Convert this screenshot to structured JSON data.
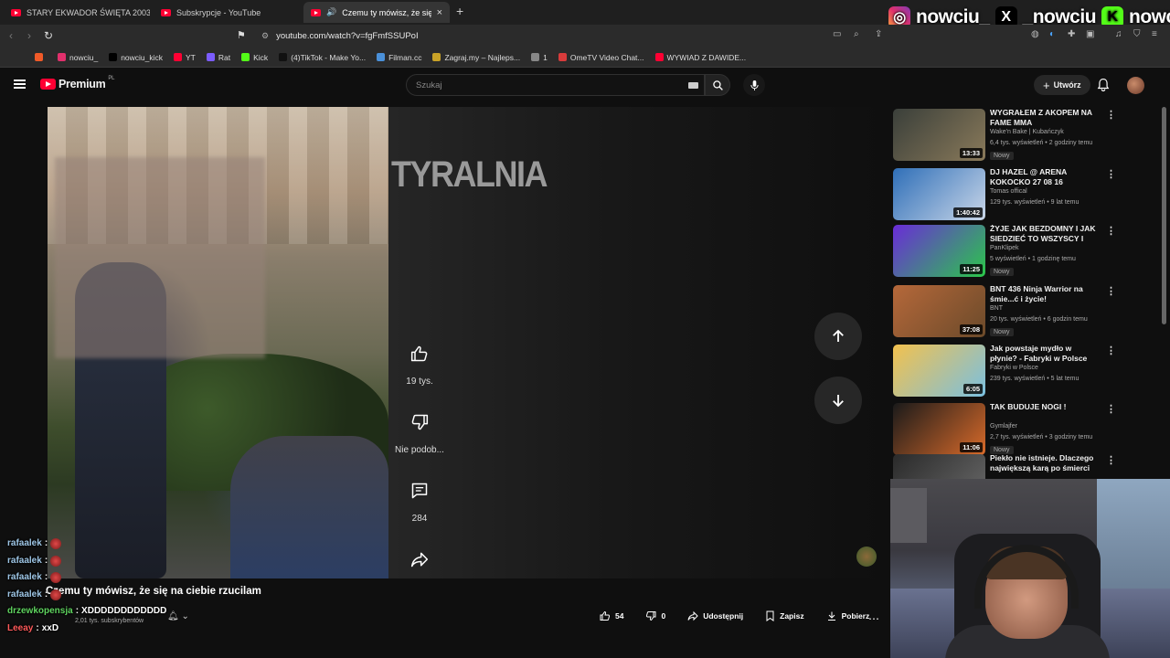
{
  "browser": {
    "tabs": [
      {
        "label": "STARY EKWADOR ŚWIĘTA 2003",
        "active": false
      },
      {
        "label": "Subskrypcje - YouTube",
        "active": false
      },
      {
        "label": "Czemu ty mówisz, że się na ci",
        "active": true
      }
    ],
    "new_tab": "+",
    "close": "×",
    "url": "youtube.com/watch?v=fgFmfSSUPoI",
    "bookmarks": [
      {
        "label": "",
        "color": "#f05a28"
      },
      {
        "label": "nowciu_",
        "color": "#e1306c"
      },
      {
        "label": "nowciu_kick",
        "color": "#000000"
      },
      {
        "label": "YT",
        "color": "#ff0033"
      },
      {
        "label": "Rat",
        "color": "#7b5cff"
      },
      {
        "label": "Kick",
        "color": "#53fc18"
      },
      {
        "label": "(4)TikTok - Make Yo...",
        "color": "#111111"
      },
      {
        "label": "Filman.cc",
        "color": "#4a90d9"
      },
      {
        "label": "Zagraj.my – Najleps...",
        "color": "#c9a227"
      },
      {
        "label": "1",
        "color": "#888888"
      },
      {
        "label": "OmeTV Video Chat...",
        "color": "#d83b3b"
      },
      {
        "label": "WYWIAD Z DAWIDE...",
        "color": "#ff0033"
      }
    ]
  },
  "socials": {
    "instagram": "nowciu_",
    "x": "_nowciu",
    "kick": "nowciu"
  },
  "youtube": {
    "logo_text": "Premium",
    "logo_region": "PL",
    "search_placeholder": "Szukaj",
    "create_label": "Utwórz",
    "overlay_title": "TYRALNIA",
    "likes": "19 tys.",
    "dislike_label": "Nie podob...",
    "comments": "284",
    "video_title": "Czemu ty mówisz, że się na ciebie rzucilam",
    "channel_subs": "2,01 tys. subskrybentów",
    "like_count": "54",
    "dislike_count": "0",
    "share_label": "Udostępnij",
    "save_label": "Zapisz",
    "download_label": "Pobierz"
  },
  "recommendations": [
    {
      "title": "WYGRAŁEM Z AKOPEM NA FAME MMA",
      "channel": "Wake'n Bake | Kubańczyk",
      "meta": "6,4 tys. wyświetleń • 2 godziny temu",
      "badge": "Nowy",
      "duration": "13:33",
      "colors": [
        "#3a3f3a",
        "#8a7a5a"
      ]
    },
    {
      "title": "DJ HAZEL @ ARENA KOKOCKO 27 08 16",
      "channel": "Tomas offical",
      "meta": "129 tys. wyświetleń • 9 lat temu",
      "badge": "",
      "duration": "1:40:42",
      "colors": [
        "#2f6fb8",
        "#c9d6e8"
      ]
    },
    {
      "title": "ŻYJE JAK BEZDOMNY I JAK SIEDZIEĆ TO WSZYSCY I 😂...",
      "channel": "PanKlipek",
      "meta": "5 wyświetleń • 1 godzinę temu",
      "badge": "Nowy",
      "duration": "11:25",
      "colors": [
        "#6a2bd8",
        "#2bc84a"
      ]
    },
    {
      "title": "BNT 436 Ninja Warrior na śmie...ć i życie!",
      "channel": "BNT",
      "meta": "20 tys. wyświetleń • 6 godzin temu",
      "badge": "Nowy",
      "duration": "37:08",
      "colors": [
        "#b5683a",
        "#6b4a2a"
      ]
    },
    {
      "title": "Jak powstaje mydło w płynie? - Fabryki w Polsce",
      "channel": "Fabryki w Polsce",
      "meta": "239 tys. wyświetleń • 5 lat temu",
      "badge": "",
      "duration": "6:05",
      "colors": [
        "#f2c14e",
        "#7ac0e0"
      ]
    },
    {
      "title": "TAK BUDUJE NOGI !",
      "channel": "Gymlajfer",
      "meta": "2,7 tys. wyświetleń • 3 godziny temu",
      "badge": "Nowy",
      "duration": "11:06",
      "colors": [
        "#1a1a1a",
        "#d86a2a"
      ]
    },
    {
      "title": "Piekło nie istnieje. Dlaczego największą karą po śmierci jes...",
      "channel": "",
      "meta": "",
      "badge": "",
      "duration": "",
      "colors": [
        "#2a2a2a",
        "#6a6a6a"
      ]
    }
  ],
  "chat": [
    {
      "user": "rafaalek",
      "msg": "",
      "color": "#9ec6e6",
      "emote": true
    },
    {
      "user": "rafaalek",
      "msg": "",
      "color": "#9ec6e6",
      "emote": true
    },
    {
      "user": "rafaalek",
      "msg": "",
      "color": "#9ec6e6",
      "emote": true
    },
    {
      "user": "rafaalek",
      "msg": "",
      "color": "#9ec6e6",
      "emote": true
    },
    {
      "user": "drzewkopensja",
      "msg": "XDDDDDDDDDDDD",
      "color": "#5fd35f",
      "emote": false
    },
    {
      "user": "Leeay",
      "msg": "xxD",
      "color": "#ff5a5a",
      "emote": false
    }
  ]
}
